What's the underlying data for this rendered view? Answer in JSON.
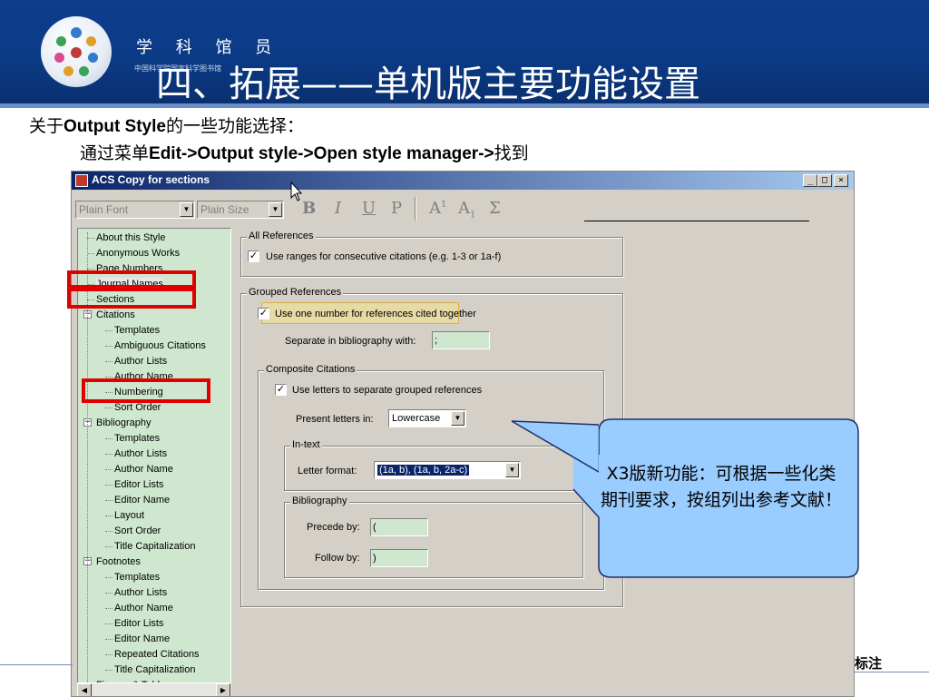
{
  "header": {
    "logo_name": "学 科 馆 员",
    "logo_sub": "中国科学院国家科学图书馆",
    "title": "四、拓展——单机版主要功能设置"
  },
  "intro": {
    "line1_prefix": "关于",
    "line1_bold": "Output Style",
    "line1_suffix": "的一些功能选择：",
    "line2_prefix": "通过菜单",
    "line2_bold": "Edit->Output style->Open style manager->",
    "line2_suffix": "找到"
  },
  "window": {
    "title": "ACS Copy for sections",
    "minimize": "_",
    "maximize": "□",
    "close": "×",
    "font_combo": "Plain Font",
    "size_combo": "Plain Size",
    "fmt_bold": "B",
    "fmt_italic": "I",
    "fmt_underline": "U",
    "fmt_plain": "P",
    "fmt_super": "A",
    "fmt_super_mark": "1",
    "fmt_sub": "A",
    "fmt_sub_mark": "1",
    "fmt_sigma": "Σ"
  },
  "tree": {
    "items": [
      {
        "label": "About this Style",
        "level": 0
      },
      {
        "label": "Anonymous Works",
        "level": 0
      },
      {
        "label": "Page Numbers",
        "level": 0
      },
      {
        "label": "Journal Names",
        "level": 0
      },
      {
        "label": "Sections",
        "level": 0
      },
      {
        "label": "Citations",
        "level": 0
      },
      {
        "label": "Templates",
        "level": 1
      },
      {
        "label": "Ambiguous Citations",
        "level": 1
      },
      {
        "label": "Author Lists",
        "level": 1
      },
      {
        "label": "Author Name",
        "level": 1
      },
      {
        "label": "Numbering",
        "level": 1
      },
      {
        "label": "Sort Order",
        "level": 1
      },
      {
        "label": "Bibliography",
        "level": 0
      },
      {
        "label": "Templates",
        "level": 1
      },
      {
        "label": "Author Lists",
        "level": 1
      },
      {
        "label": "Author Name",
        "level": 1
      },
      {
        "label": "Editor Lists",
        "level": 1
      },
      {
        "label": "Editor Name",
        "level": 1
      },
      {
        "label": "Layout",
        "level": 1
      },
      {
        "label": "Sort Order",
        "level": 1
      },
      {
        "label": "Title Capitalization",
        "level": 1
      },
      {
        "label": "Footnotes",
        "level": 0
      },
      {
        "label": "Templates",
        "level": 1
      },
      {
        "label": "Author Lists",
        "level": 1
      },
      {
        "label": "Author Name",
        "level": 1
      },
      {
        "label": "Editor Lists",
        "level": 1
      },
      {
        "label": "Editor Name",
        "level": 1
      },
      {
        "label": "Repeated Citations",
        "level": 1
      },
      {
        "label": "Title Capitalization",
        "level": 1
      },
      {
        "label": "Figures & Tables",
        "level": 0
      }
    ]
  },
  "panel": {
    "all_refs_legend": "All References",
    "ranges_label": "Use ranges for consecutive citations (e.g. 1-3 or 1a-f)",
    "ranges_checked": true,
    "grouped_legend": "Grouped References",
    "one_number_label": "Use one number for references cited together",
    "one_number_checked": true,
    "separate_label": "Separate in bibliography with:",
    "separate_value": ";",
    "composite_legend": "Composite Citations",
    "letters_label": "Use letters to separate grouped references",
    "letters_checked": true,
    "present_label": "Present letters in:",
    "present_value": "Lowercase",
    "intext_legend": "In-text",
    "letter_format_label": "Letter format:",
    "letter_format_value": "(1a, b), (1a, b, 2a-c)",
    "biblio_legend": "Bibliography",
    "precede_label": "Precede by:",
    "precede_value": "(",
    "follow_label": "Follow by:",
    "follow_value": ")"
  },
  "callout": {
    "text": "X3版新功能：可根据一些化类期刊要求，按组列出参考文献！"
  },
  "footer": {
    "text": "标注"
  },
  "colors": {
    "header_blue": "#0d3d8c",
    "tree_green": "#cfe7cf",
    "callout_fill": "#99ccff",
    "red_highlight": "#e00000"
  }
}
